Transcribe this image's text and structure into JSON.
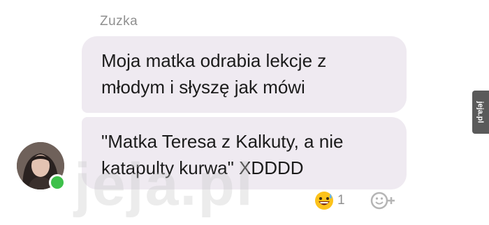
{
  "conversation": {
    "sender_name": "Zuzka"
  },
  "messages": [
    {
      "lines": [
        "Moja matka odrabia lekcje z",
        "młodym i słyszę jak mówi"
      ]
    },
    {
      "lines": [
        "\"Matka Teresa z Kalkuty, a nie",
        "katapulty kurwa\" XDDDD"
      ]
    }
  ],
  "reactions": {
    "emoji_icon": "grinning-sweat-face",
    "count": "1",
    "add_icon": "add-reaction-icon"
  },
  "watermark": {
    "text": "jeja.pl"
  },
  "side_logo": {
    "text": "jeja.pl"
  },
  "colors": {
    "bubble": "#efeaf1",
    "online": "#3ec04a",
    "name": "#8f8f8f"
  }
}
